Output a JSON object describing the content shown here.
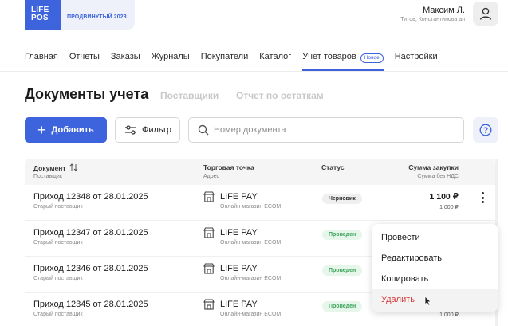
{
  "header": {
    "logo_line1": "LIFE",
    "logo_line2": "POS",
    "plan": "ПРОДВИНУТЫЙ 2023",
    "user_name": "Максим Л.",
    "user_org": "Титов, Константинова ап"
  },
  "nav": {
    "items": [
      {
        "label": "Главная"
      },
      {
        "label": "Отчеты"
      },
      {
        "label": "Заказы"
      },
      {
        "label": "Журналы"
      },
      {
        "label": "Покупатели"
      },
      {
        "label": "Каталог"
      },
      {
        "label": "Учет товаров",
        "badge": "Новое",
        "active": true
      },
      {
        "label": "Настройки"
      }
    ]
  },
  "page": {
    "title": "Документы учета",
    "tabs": [
      "Поставщики",
      "Отчет по остаткам"
    ]
  },
  "toolbar": {
    "add_label": "Добавить",
    "filter_label": "Фильтр",
    "search_placeholder": "Номер документа",
    "help_icon": "question-icon"
  },
  "table": {
    "columns": [
      {
        "title": "Документ",
        "subtitle": "Поставщик"
      },
      {
        "title": "Торговая точка",
        "subtitle": "Адрес"
      },
      {
        "title": "Статус",
        "subtitle": ""
      },
      {
        "title": "Сумма закупки",
        "subtitle": "Сумма без НДС"
      }
    ],
    "rows": [
      {
        "doc": "Приход 12348 от 28.01.2025",
        "supplier": "Старый поставщик",
        "store": "LIFE PAY",
        "address": "Онлайн-магазин ECOM",
        "status": "Черновик",
        "status_kind": "draft",
        "sum": "1 100 ₽",
        "sum_net": "1 000 ₽"
      },
      {
        "doc": "Приход 12347 от 28.01.2025",
        "supplier": "Старый поставщик",
        "store": "LIFE PAY",
        "address": "Онлайн-магазин ECOM",
        "status": "Проведен",
        "status_kind": "done",
        "sum": "",
        "sum_net": ""
      },
      {
        "doc": "Приход 12346 от 28.01.2025",
        "supplier": "Старый поставщик",
        "store": "LIFE PAY",
        "address": "Онлайн-магазин ECOM",
        "status": "Проведен",
        "status_kind": "done",
        "sum": "",
        "sum_net": ""
      },
      {
        "doc": "Приход 12345 от 28.01.2025",
        "supplier": "Старый поставщик",
        "store": "LIFE PAY",
        "address": "Онлайн-магазин ECOM",
        "status": "Проведен",
        "status_kind": "done",
        "sum": "",
        "sum_net": "1 000 ₽"
      }
    ]
  },
  "context_menu": {
    "items": [
      "Провести",
      "Редактировать",
      "Копировать",
      "Удалить"
    ]
  },
  "colors": {
    "accent": "#3d63dd",
    "danger": "#d63b3b",
    "success": "#3aa35a"
  }
}
